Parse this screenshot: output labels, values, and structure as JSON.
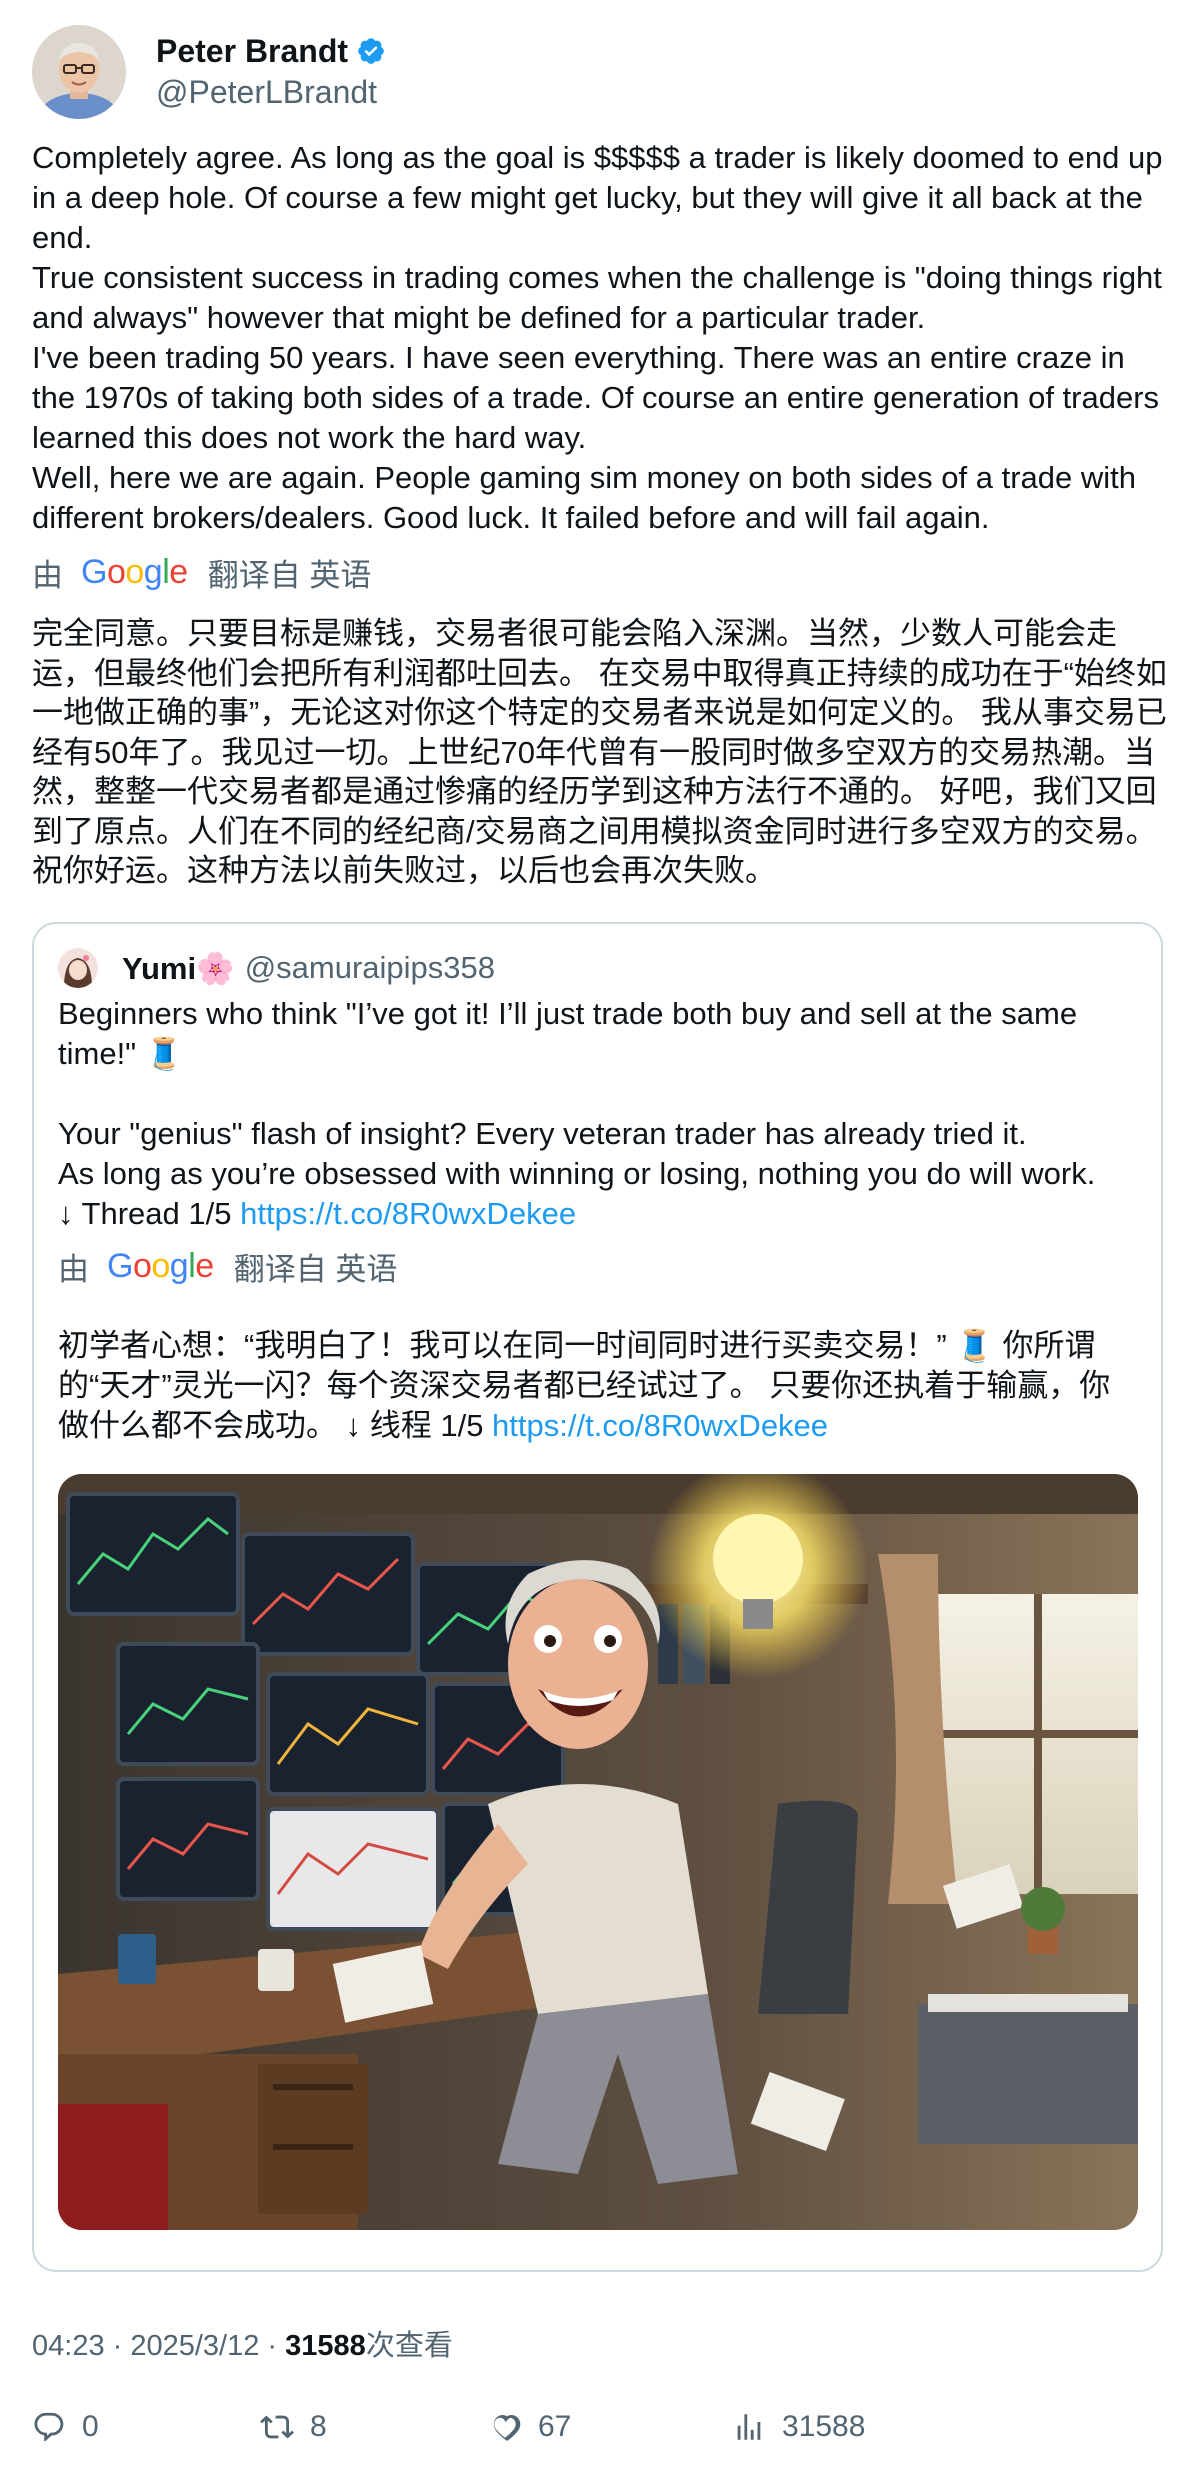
{
  "author": {
    "display_name": "Peter Brandt",
    "handle": "@PeterLBrandt"
  },
  "tweet": {
    "text": "Completely agree. As long as the goal is $$$$$ a trader is likely doomed to end up in a deep hole. Of course a few might get lucky, but they will give it all back at the end.\nTrue consistent success in trading comes when the challenge is \"doing things right and always\" however that might be defined for a particular trader.\nI've been trading 50 years. I have seen everything. There was an entire craze in the 1970s of taking both sides of a trade. Of course an entire generation of traders learned this does not work the hard way.\nWell, here we are again. People gaming sim money on both sides of a trade with different brokers/dealers. Good luck. It failed before and will fail again.",
    "translate_prefix": "由",
    "translate_suffix": "翻译自 英语",
    "translated_text": "完全同意。只要目标是赚钱，交易者很可能会陷入深渊。当然，少数人可能会走运，但最终他们会把所有利润都吐回去。 在交易中取得真正持续的成功在于“始终如一地做正确的事”，无论这对你这个特定的交易者来说是如何定义的。 我从事交易已经有50年了。我见过一切。上世纪70年代曾有一股同时做多空双方的交易热潮。当然，整整一代交易者都是通过惨痛的经历学到这种方法行不通的。 好吧，我们又回到了原点。人们在不同的经纪商/交易商之间用模拟资金同时进行多空双方的交易。祝你好运。这种方法以前失败过，以后也会再次失败。"
  },
  "google_logo": [
    "G",
    "o",
    "o",
    "g",
    "l",
    "e"
  ],
  "quoted": {
    "display_name": "Yumi🌸",
    "handle": "@samuraipips358",
    "text": "Beginners who think \"I’ve got it! I’ll just trade both buy and sell at the same time!\" 🧵\n\nYour \"genius\" flash of insight? Every veteran trader has already tried it.\nAs long as you’re obsessed with winning or losing, nothing you do will work.\n↓ Thread 1/5 ",
    "link": "https://t.co/8R0wxDekee",
    "translate_prefix": "由",
    "translate_suffix": "翻译自 英语",
    "translated_text": "初学者心想：“我明白了！我可以在同一时间同时进行买卖交易！” 🧵 你所谓的“天才”灵光一闪？每个资深交易者都已经试过了。 只要你还执着于输赢，你做什么都不会成功。 ↓ 线程 1/5 ",
    "translated_link": "https://t.co/8R0wxDekee"
  },
  "meta": {
    "time": "04:23",
    "sep1": " · ",
    "date": "2025/3/12",
    "sep2": " · ",
    "views": "31588",
    "views_label": "次查看"
  },
  "actions": {
    "replies": "0",
    "retweets": "8",
    "likes": "67",
    "views": "31588"
  },
  "colors": {
    "link": "#1d9bf0",
    "muted": "#536471",
    "border": "#cfd9de",
    "verified": "#1d9bf0"
  }
}
